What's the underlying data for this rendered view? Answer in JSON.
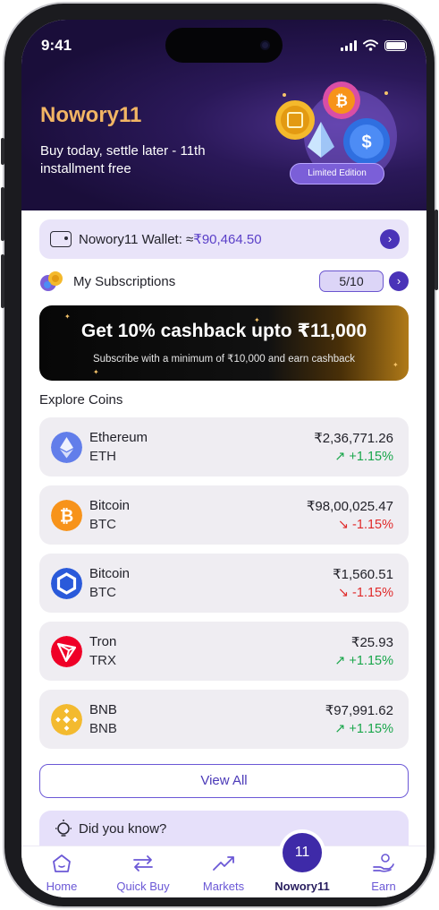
{
  "status": {
    "time": "9:41"
  },
  "header": {
    "brand": "Nowory11",
    "tagline": "Buy today, settle later - 11th installment free",
    "badge": "Limited Edition"
  },
  "wallet": {
    "label": "Nowory11 Wallet: ≈",
    "amount": "₹90,464.50"
  },
  "subscriptions": {
    "label": "My Subscriptions",
    "count": "5/10"
  },
  "promo": {
    "title": "Get 10% cashback upto ₹11,000",
    "subtitle": "Subscribe with a minimum of ₹10,000 and earn cashback"
  },
  "explore": {
    "title": "Explore Coins",
    "coins": [
      {
        "name": "Ethereum",
        "symbol": "ETH",
        "price": "₹2,36,771.26",
        "change": "+1.15%",
        "trend": "up",
        "icon": "ethereum-icon",
        "color": "#627eea"
      },
      {
        "name": "Bitcoin",
        "symbol": "BTC",
        "price": "₹98,00,025.47",
        "change": "-1.15%",
        "trend": "down",
        "icon": "bitcoin-icon",
        "color": "#f7931a"
      },
      {
        "name": "Bitcoin",
        "symbol": "BTC",
        "price": "₹1,560.51",
        "change": "-1.15%",
        "trend": "down",
        "icon": "chainlink-icon",
        "color": "#2a5ada"
      },
      {
        "name": "Tron",
        "symbol": "TRX",
        "price": "₹25.93",
        "change": "+1.15%",
        "trend": "up",
        "icon": "tron-icon",
        "color": "#ef0027"
      },
      {
        "name": "BNB",
        "symbol": "BNB",
        "price": "₹97,991.62",
        "change": "+1.15%",
        "trend": "up",
        "icon": "bnb-icon",
        "color": "#f3ba2f"
      }
    ],
    "view_all": "View All"
  },
  "did_you_know": {
    "label": "Did you know?"
  },
  "tabs": [
    {
      "label": "Home",
      "icon": "home-icon"
    },
    {
      "label": "Quick Buy",
      "icon": "swap-arrows-icon"
    },
    {
      "label": "Markets",
      "icon": "trend-up-icon"
    },
    {
      "label": "Nowory11",
      "icon": "nowory11-icon",
      "active": true
    },
    {
      "label": "Earn",
      "icon": "earn-hand-icon"
    }
  ],
  "center_button": "11",
  "colors": {
    "accent": "#4a33b8",
    "brand_gold": "#f2b564",
    "up": "#19a64b",
    "down": "#e02a2a"
  }
}
